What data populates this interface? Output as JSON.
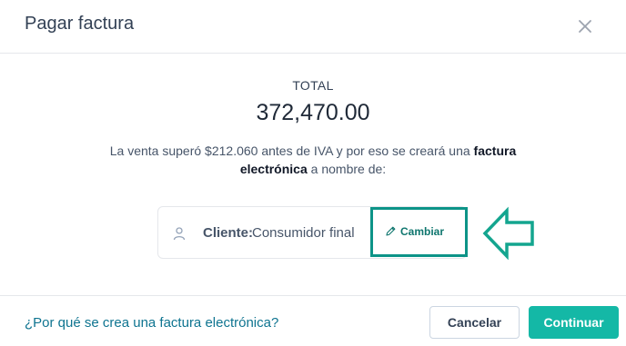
{
  "dialog": {
    "title": "Pagar factura"
  },
  "total": {
    "label": "TOTAL",
    "amount": "372,470.00"
  },
  "message": {
    "part1": "La venta superó $212.060 antes de IVA y por eso se creará una ",
    "bold1": "factura electrónica",
    "part2": " a nombre de:"
  },
  "client": {
    "label": "Cliente:",
    "value": "Consumidor final",
    "change_label": "Cambiar"
  },
  "footer": {
    "help_link": "¿Por qué se crea una factura electrónica?",
    "cancel_label": "Cancelar",
    "continue_label": "Continuar"
  },
  "colors": {
    "accent": "#14b8a6",
    "highlight_border": "#0d9488",
    "link": "#0e7490"
  },
  "icons": {
    "close": "close-icon",
    "person": "person-icon",
    "pencil": "pencil-icon",
    "arrow": "left-arrow-icon"
  }
}
